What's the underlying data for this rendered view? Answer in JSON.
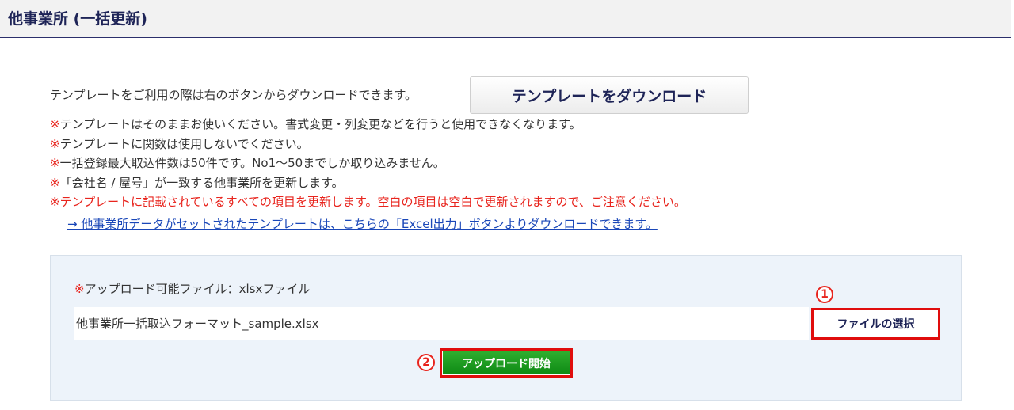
{
  "header": {
    "title": "他事業所 (一括更新)"
  },
  "intro": {
    "text": "テンプレートをご利用の際は右のボタンからダウンロードできます。",
    "download_button": "テンプレートをダウンロード"
  },
  "notes": [
    {
      "mark": "※",
      "text": "テンプレートはそのままお使いください。書式変更・列変更などを行うと使用できなくなります。"
    },
    {
      "mark": "※",
      "text": "テンプレートに関数は使用しないでください。"
    },
    {
      "mark": "※",
      "text": "一括登録最大取込件数は50件です。No1～50までしか取り込みません。"
    },
    {
      "mark": "※",
      "text": "「会社名 / 屋号」が一致する他事業所を更新します。"
    }
  ],
  "warning": "※テンプレートに記載されているすべての項目を更新します。空白の項目は空白で更新されますので、ご注意ください。",
  "link": "→ 他事業所データがセットされたテンプレートは、こちらの「Excel出力」ボタンよりダウンロードできます。",
  "upload": {
    "note_mark": "※",
    "note_text": "アップロード可能ファイル：xlsxファイル",
    "file_value": "他事業所一括取込フォーマット_sample.xlsx",
    "choose_button": "ファイルの選択",
    "upload_button": "アップロード開始",
    "step1": "1",
    "step2": "2"
  },
  "colors": {
    "accent_red": "#e8241d",
    "navy": "#1e2457",
    "green": "#14921a",
    "panel_bg": "#edf3fa"
  }
}
